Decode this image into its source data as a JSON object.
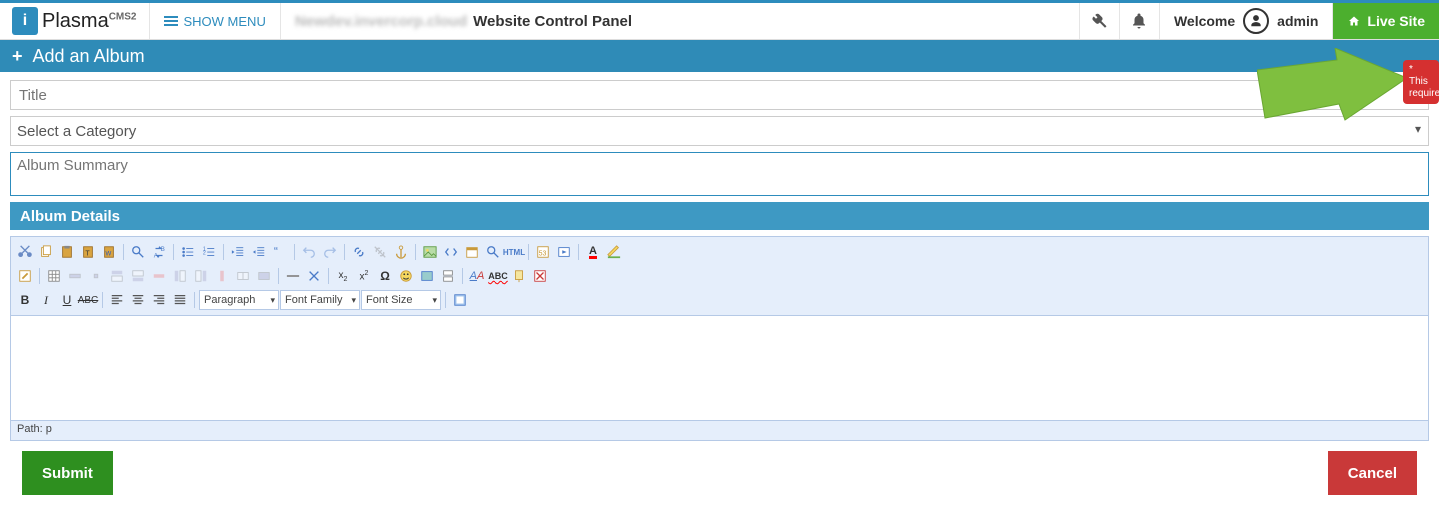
{
  "topbar": {
    "logo_letter": "i",
    "logo_text": "Plasma",
    "logo_suffix": "CMS2",
    "menu_toggle": "SHOW MENU",
    "title_prefix_blur": "Newdev.invercorp.cloud",
    "title": "Website Control Panel",
    "welcome": "Welcome",
    "username": "admin",
    "live_site": "Live Site"
  },
  "section": {
    "header": "Add an Album",
    "title_placeholder": "Title",
    "category_placeholder": "Select a Category",
    "summary_placeholder": "Album Summary",
    "details_header": "Album Details"
  },
  "editor": {
    "paragraph": "Paragraph",
    "font_family": "Font Family",
    "font_size": "Font Size",
    "path": "Path: p"
  },
  "buttons": {
    "submit": "Submit",
    "cancel": "Cancel"
  },
  "tooltip": {
    "text": "* This\nrequire"
  },
  "icons": {
    "tools": "tools",
    "bell": "bell",
    "user": "user",
    "home": "home"
  }
}
